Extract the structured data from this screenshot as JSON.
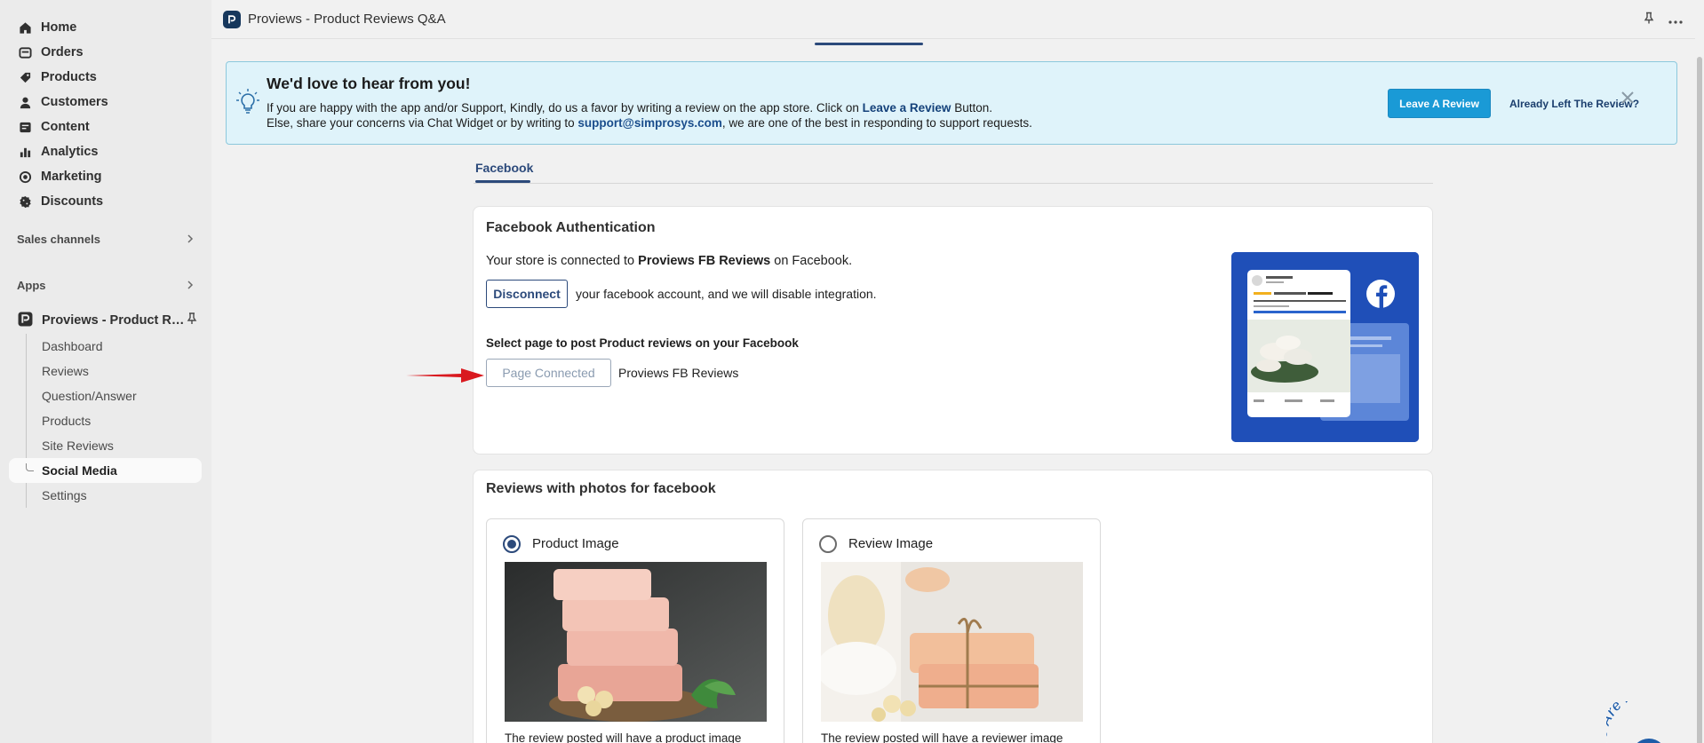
{
  "sidebar": {
    "items": [
      {
        "label": "Home",
        "icon": "home-icon"
      },
      {
        "label": "Orders",
        "icon": "orders-icon"
      },
      {
        "label": "Products",
        "icon": "products-icon"
      },
      {
        "label": "Customers",
        "icon": "customers-icon"
      },
      {
        "label": "Content",
        "icon": "content-icon"
      },
      {
        "label": "Analytics",
        "icon": "analytics-icon"
      },
      {
        "label": "Marketing",
        "icon": "marketing-icon"
      },
      {
        "label": "Discounts",
        "icon": "discounts-icon"
      }
    ],
    "sales_channels": "Sales channels",
    "apps": "Apps",
    "app_name": "Proviews - Product Re...",
    "sub_items": [
      "Dashboard",
      "Reviews",
      "Question/Answer",
      "Products",
      "Site Reviews",
      "Social Media",
      "Settings"
    ],
    "active_sub": "Social Media"
  },
  "topbar": {
    "title": "Proviews - Product Reviews Q&A"
  },
  "banner": {
    "heading": "We'd love to hear from you!",
    "line1_pre": "If you are happy with the app and/or Support, Kindly, do us a favor by writing a review on the app store. Click on ",
    "line1_link": "Leave a Review",
    "line1_post": " Button.",
    "line2_pre": "Else, share your concerns via Chat Widget or by writing to ",
    "line2_email": "support@simprosys.com",
    "line2_post": ", we are one of the best in responding to support requests.",
    "leave_review_label": "Leave A Review",
    "already_left_label": "Already Left The Review?",
    "accent_color": "#1a9ad6"
  },
  "tabs": {
    "facebook": "Facebook"
  },
  "fb_auth": {
    "heading": "Facebook Authentication",
    "connected_pre": "Your store is connected to ",
    "connected_name": "Proviews FB Reviews",
    "connected_post": " on Facebook.",
    "disconnect_label": "Disconnect",
    "disconnect_text": "your facebook account, and we will disable integration.",
    "select_label": "Select page to post Product reviews on your Facebook",
    "page_connected_label": "Page Connected",
    "page_name": "Proviews FB Reviews"
  },
  "photos": {
    "heading": "Reviews with photos for facebook",
    "option1_label": "Product Image",
    "option1_desc": "The review posted will have a product image",
    "option2_label": "Review Image",
    "option2_desc": "The review posted will have a reviewer image",
    "selected": "Product Image"
  },
  "corner_badge": "We Are Here!"
}
